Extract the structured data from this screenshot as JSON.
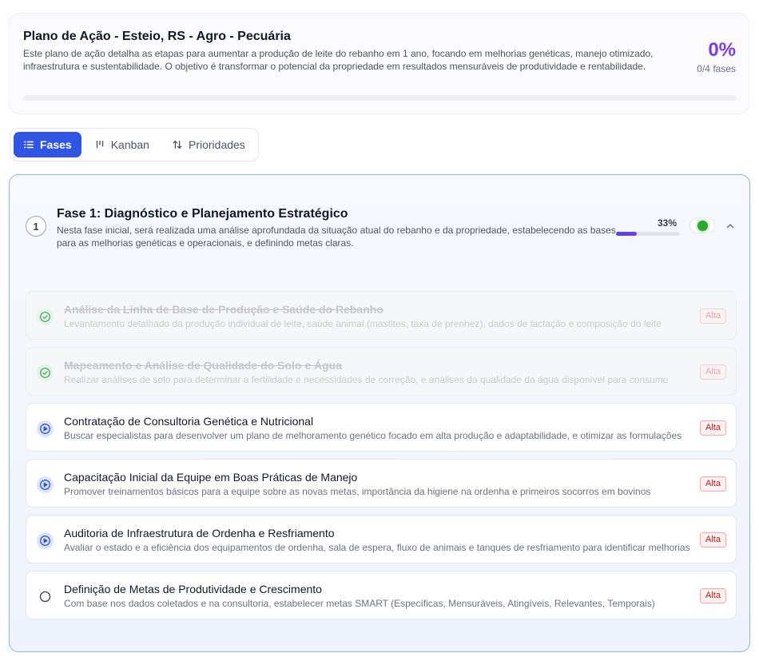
{
  "plan": {
    "title": "Plano de Ação - Esteio, RS - Agro - Pecuária",
    "description": "Este plano de ação detalha as etapas para aumentar a produção de leite do rebanho em 1 ano, focando em melhorias genéticas, manejo otimizado, infraestrutura e sustentabilidade. O objetivo é transformar o potencial da propriedade em resultados mensuráveis de produtividade e rentabilidade.",
    "progress_text": "0%",
    "progress_fraction": 0,
    "phases_count": "0/4 fases"
  },
  "tabs": [
    {
      "label": "Fases",
      "icon": "list-icon",
      "active": true
    },
    {
      "label": "Kanban",
      "icon": "kanban-icon",
      "active": false
    },
    {
      "label": "Prioridades",
      "icon": "sort-icon",
      "active": false
    }
  ],
  "phase": {
    "number": "1",
    "title": "Fase 1: Diagnóstico e Planejamento Estratégico",
    "description": "Nesta fase inicial, será realizada uma análise aprofundada da situação atual do rebanho e da propriedade, estabelecendo as bases para as melhorias genéticas e operacionais, e definindo metas claras.",
    "progress_text": "33%",
    "progress_fraction": 0.33,
    "status_color": "#2ea82e",
    "expanded_icon": "chevron-up-icon"
  },
  "tasks": [
    {
      "title": "Análise da Linha de Base de Produção e Saúde do Rebanho",
      "description": "Levantamento detalhado da produção individual de leite, saúde animal (mastites, taxa de prenhez), dados de lactação e composição do leite",
      "priority": "Alta",
      "status": "done"
    },
    {
      "title": "Mapeamento e Análise de Qualidade do Solo e Água",
      "description": "Realizar análises de solo para determinar a fertilidade e necessidades de correção, e análises da qualidade da água disponível para consumo",
      "priority": "Alta",
      "status": "done"
    },
    {
      "title": "Contratação de Consultoria Genética e Nutricional",
      "description": "Buscar especialistas para desenvolver um plano de melhoramento genético focado em alta produção e adaptabilidade, e otimizar as formulações",
      "priority": "Alta",
      "status": "in-progress"
    },
    {
      "title": "Capacitação Inicial da Equipe em Boas Práticas de Manejo",
      "description": "Promover treinamentos básicos para a equipe sobre as novas metas, importância da higiene na ordenha e primeiros socorros em bovinos",
      "priority": "Alta",
      "status": "in-progress"
    },
    {
      "title": "Auditoria de Infraestrutura de Ordenha e Resfriamento",
      "description": "Avaliar o estado e a eficiência dos equipamentos de ordenha, sala de espera, fluxo de animais e tanques de resfriamento para identificar melhorias",
      "priority": "Alta",
      "status": "in-progress"
    },
    {
      "title": "Definição de Metas de Produtividade e Crescimento",
      "description": "Com base nos dados coletados e na consultoria, estabelecer metas SMART (Específicas, Mensuráveis, Atingíveis, Relevantes, Temporais)",
      "priority": "Alta",
      "status": "todo"
    }
  ]
}
